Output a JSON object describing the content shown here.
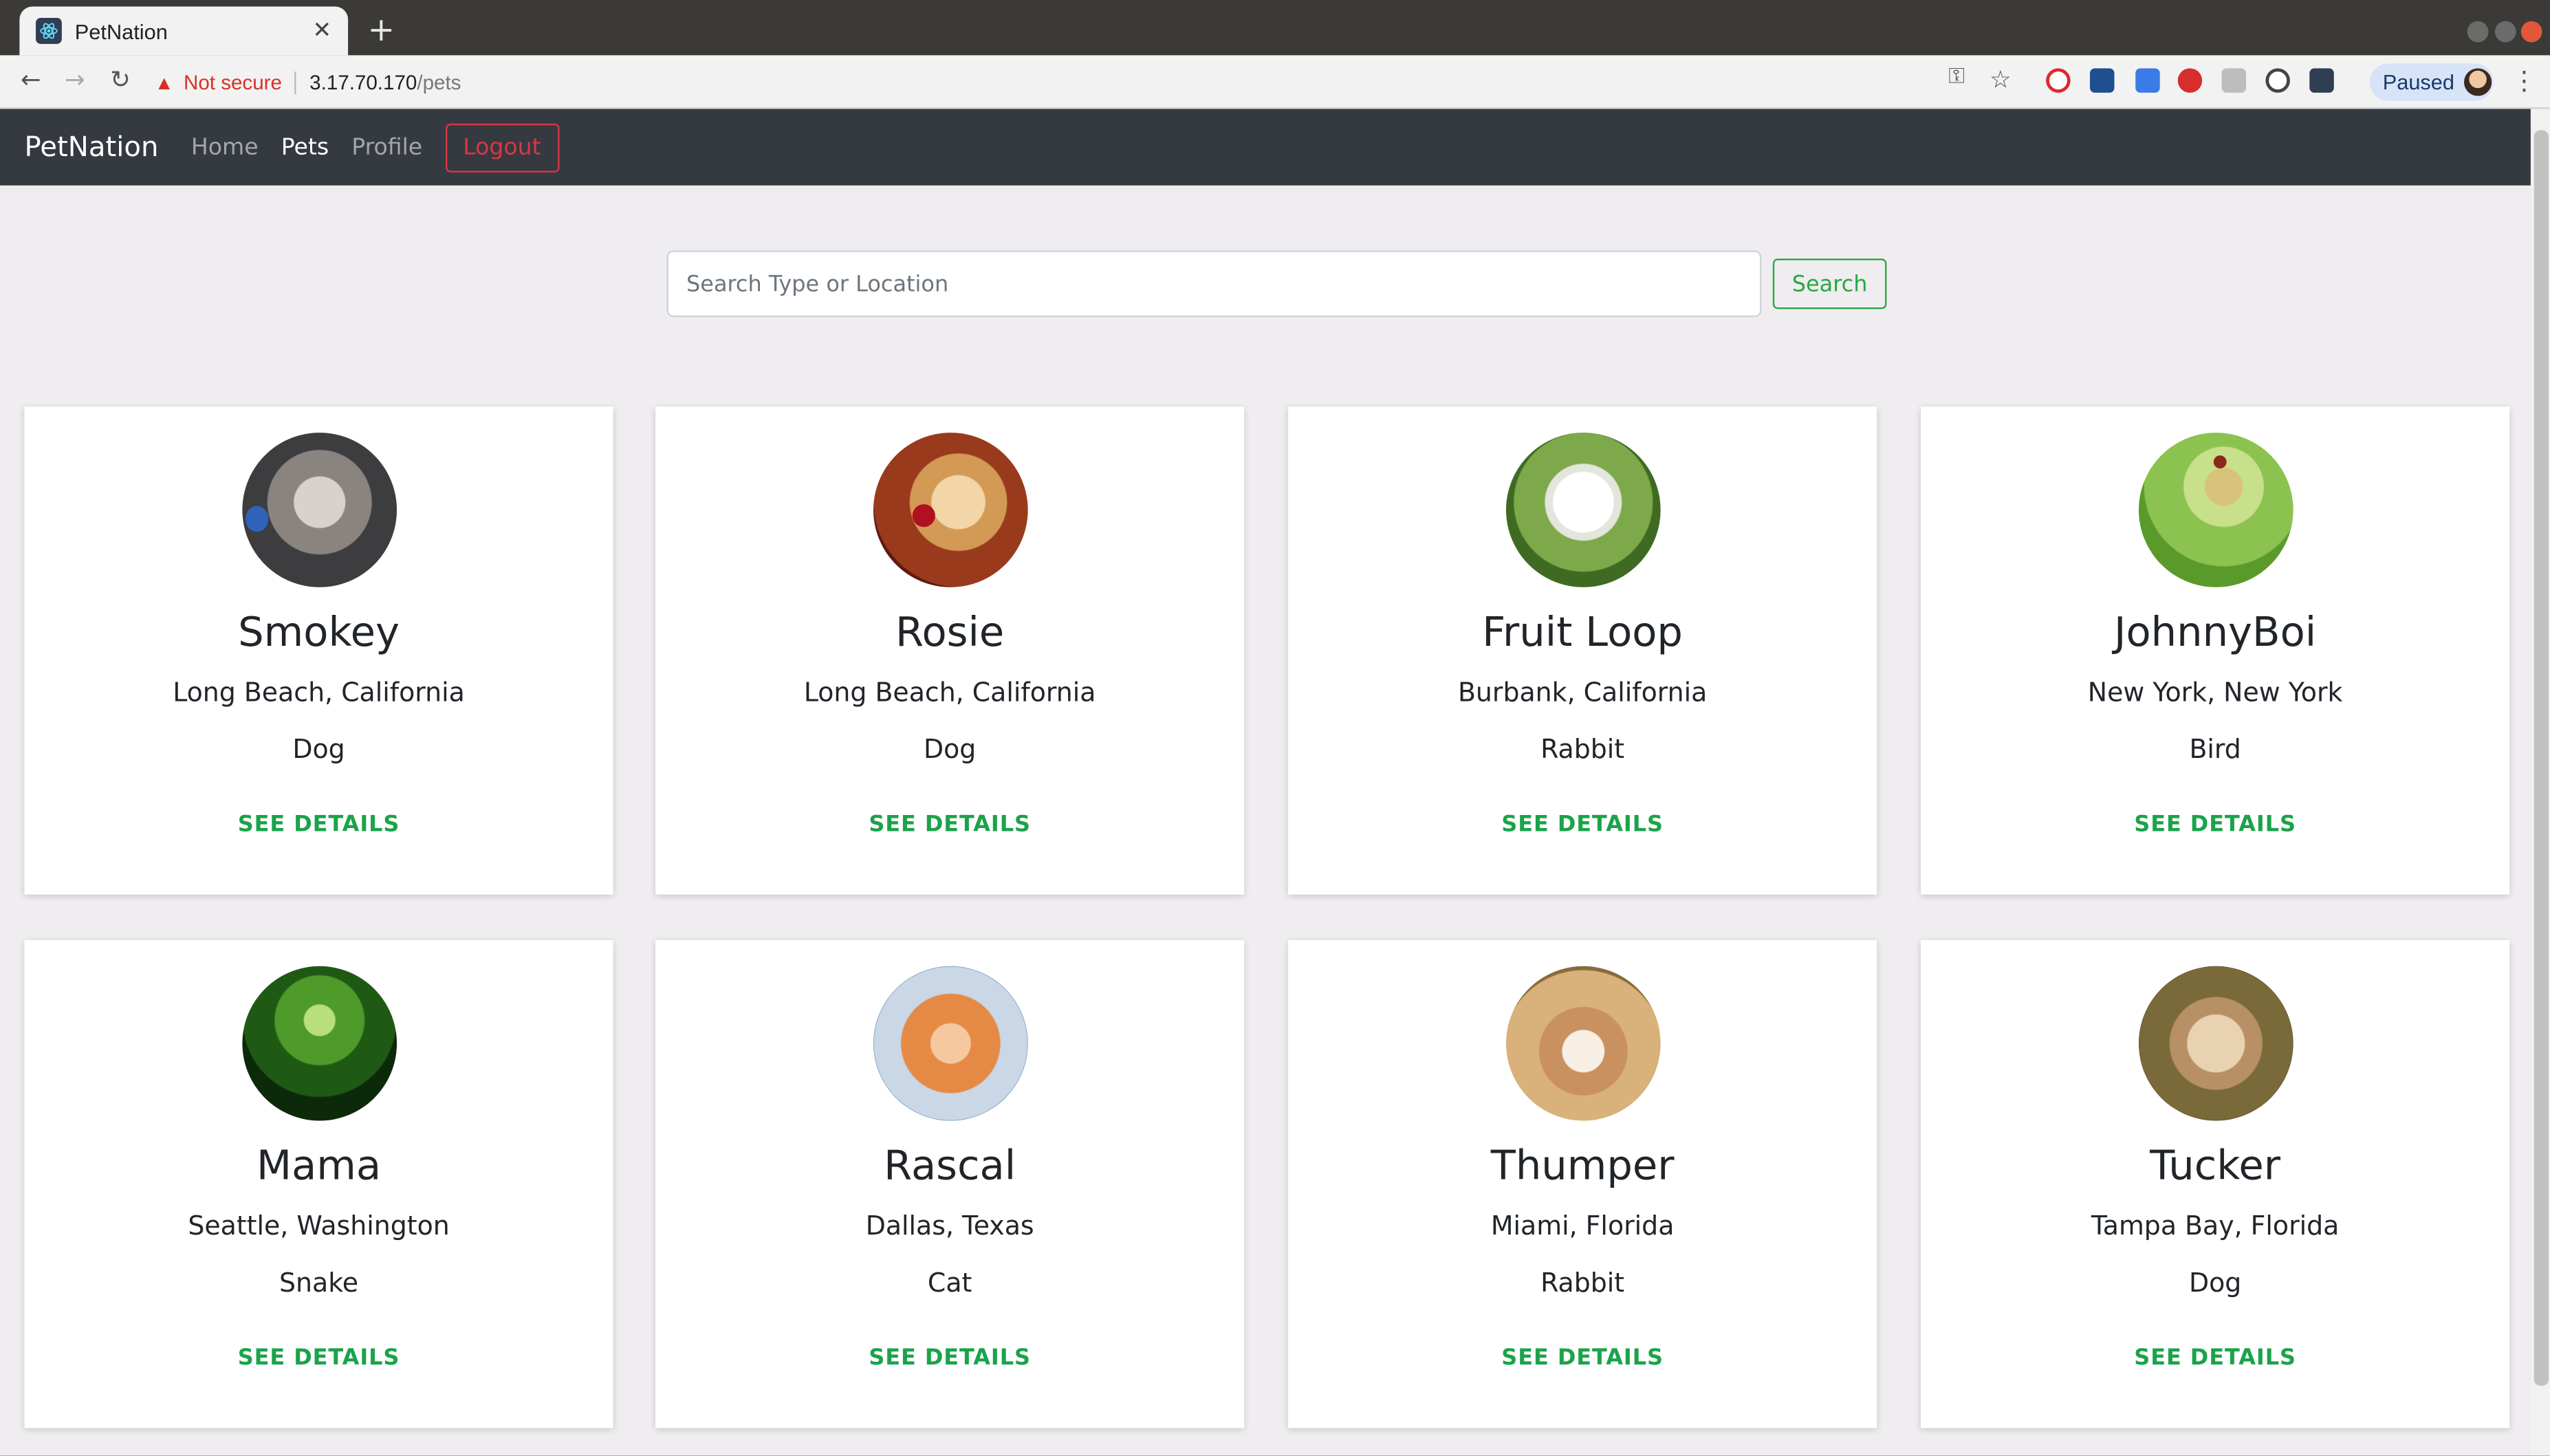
{
  "browser": {
    "tab_title": "PetNation",
    "tab_close": "✕",
    "new_tab": "+",
    "security_label": "Not secure",
    "url_host": "3.17.70.170",
    "url_path": "/pets",
    "profile_status": "Paused"
  },
  "navbar": {
    "brand": "PetNation",
    "links": [
      "Home",
      "Pets",
      "Profile"
    ],
    "active_link": "Pets",
    "logout_label": "Logout"
  },
  "search": {
    "placeholder": "Search Type or Location",
    "button_label": "Search"
  },
  "pets": [
    {
      "name": "Smokey",
      "location": "Long Beach, California",
      "type": "Dog",
      "action": "SEE DETAILS"
    },
    {
      "name": "Rosie",
      "location": "Long Beach, California",
      "type": "Dog",
      "action": "SEE DETAILS"
    },
    {
      "name": "Fruit Loop",
      "location": "Burbank, California",
      "type": "Rabbit",
      "action": "SEE DETAILS"
    },
    {
      "name": "JohnnyBoi",
      "location": "New York, New York",
      "type": "Bird",
      "action": "SEE DETAILS"
    },
    {
      "name": "Mama",
      "location": "Seattle, Washington",
      "type": "Snake",
      "action": "SEE DETAILS"
    },
    {
      "name": "Rascal",
      "location": "Dallas, Texas",
      "type": "Cat",
      "action": "SEE DETAILS"
    },
    {
      "name": "Thumper",
      "location": "Miami, Florida",
      "type": "Rabbit",
      "action": "SEE DETAILS"
    },
    {
      "name": "Tucker",
      "location": "Tampa Bay, Florida",
      "type": "Dog",
      "action": "SEE DETAILS"
    }
  ],
  "colors": {
    "navbar_bg": "#343a40",
    "page_bg": "#efedef",
    "logout": "#dc3545",
    "search_button": "#28a745",
    "details_link": "#1ba34a"
  }
}
